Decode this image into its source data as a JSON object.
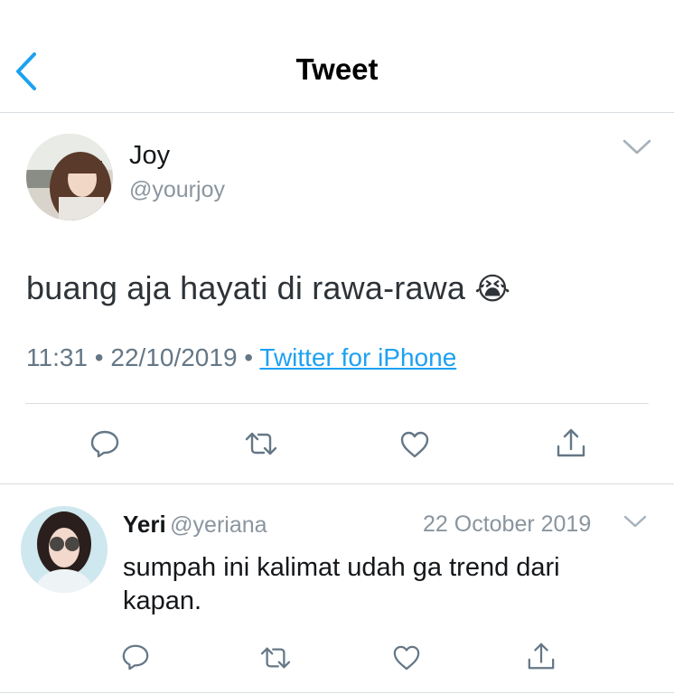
{
  "header": {
    "title": "Tweet"
  },
  "tweet": {
    "author_name": "Joy",
    "author_handle": "@yourjoy",
    "text": "buang aja hayati di rawa-rawa",
    "emoji": "😭",
    "time": "11:31",
    "date": "22/10/2019",
    "separator": "•",
    "source": "Twitter for iPhone"
  },
  "reply": {
    "author_name": "Yeri",
    "author_handle": "@yeriana",
    "date": "22 October 2019",
    "text": "sumpah ini kalimat udah ga trend dari kapan."
  },
  "colors": {
    "accent": "#1da1f2",
    "back_arrow": "#1da1f2",
    "muted": "#8a959f",
    "divider": "#d8dee2"
  },
  "icons": [
    "back-chevron-icon",
    "chevron-down-icon",
    "reply-icon",
    "retweet-icon",
    "like-icon",
    "share-icon"
  ]
}
